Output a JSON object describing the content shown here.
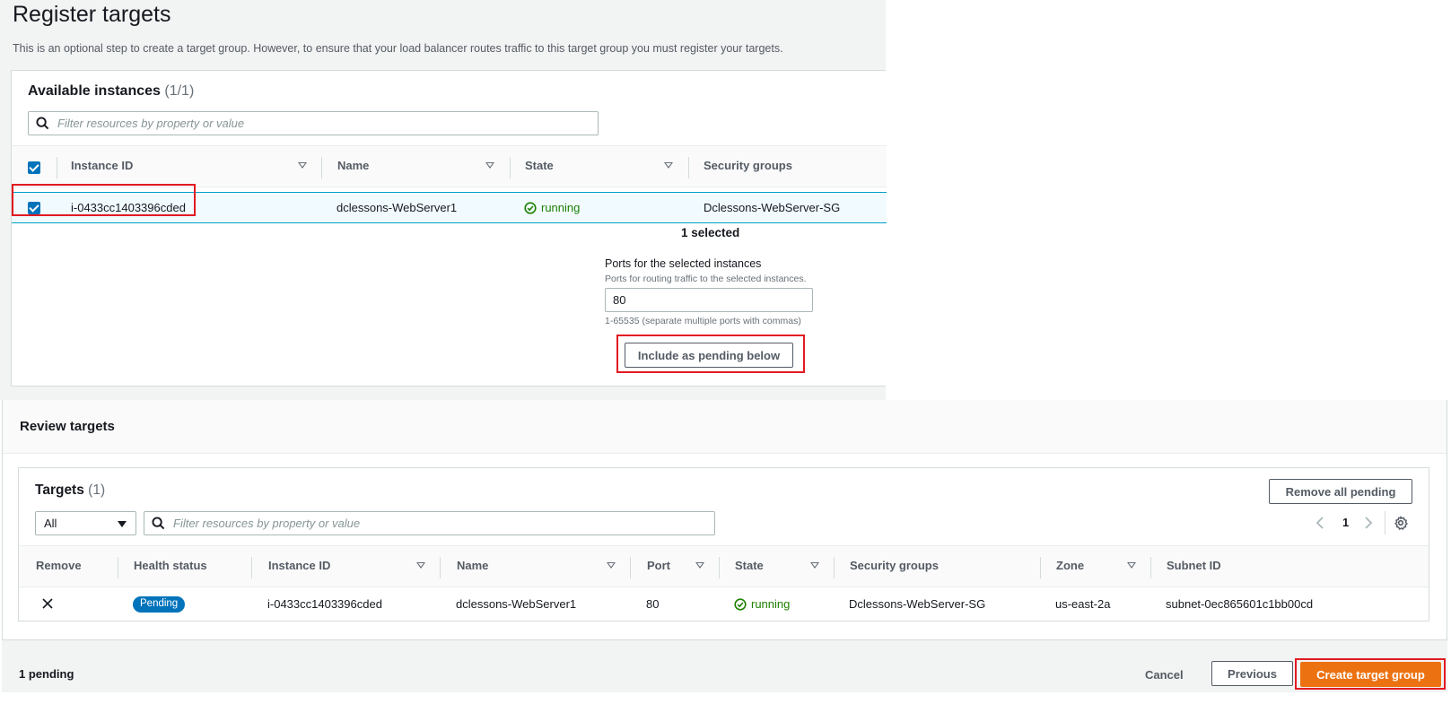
{
  "register": {
    "title": "Register targets",
    "description": "This is an optional step to create a target group. However, to ensure that your load balancer routes traffic to this target group you must register your targets."
  },
  "available": {
    "title": "Available instances",
    "count": "(1/1)",
    "search_placeholder": "Filter resources by property or value",
    "columns": [
      "Instance ID",
      "Name",
      "State",
      "Security groups"
    ],
    "row": {
      "instance_id": "i-0433cc1403396cded",
      "name": "dclessons-WebServer1",
      "state": "running",
      "security_group": "Dclessons-WebServer-SG",
      "checked": true
    },
    "selected_text": "1 selected",
    "ports_label": "Ports for the selected instances",
    "ports_desc": "Ports for routing traffic to the selected instances.",
    "ports_value": "80",
    "ports_hint": "1-65535 (separate multiple ports with commas)",
    "include_button": "Include as pending below"
  },
  "review": {
    "title": "Review targets",
    "targets_title": "Targets",
    "targets_count": "(1)",
    "remove_all_button": "Remove all pending",
    "filter_select": "All",
    "search_placeholder": "Filter resources by property or value",
    "page_number": "1",
    "columns": [
      "Remove",
      "Health status",
      "Instance ID",
      "Name",
      "Port",
      "State",
      "Security groups",
      "Zone",
      "Subnet ID"
    ],
    "row": {
      "health": "Pending",
      "instance_id": "i-0433cc1403396cded",
      "name": "dclessons-WebServer1",
      "port": "80",
      "state": "running",
      "security_group": "Dclessons-WebServer-SG",
      "zone": "us-east-2a",
      "subnet": "subnet-0ec865601c1bb00cd"
    }
  },
  "footer": {
    "pending_text": "1 pending",
    "cancel": "Cancel",
    "previous": "Previous",
    "create": "Create target group"
  },
  "colors": {
    "accent": "#0073bb",
    "primary_button": "#ec7211",
    "running": "#1d8102",
    "highlight_box": "#e21a22"
  },
  "icons": [
    "search-icon",
    "checkbox-icon",
    "sort-icon",
    "status-ok-icon",
    "close-icon",
    "chevron-left-icon",
    "chevron-right-icon",
    "gear-icon",
    "caret-down-icon"
  ]
}
